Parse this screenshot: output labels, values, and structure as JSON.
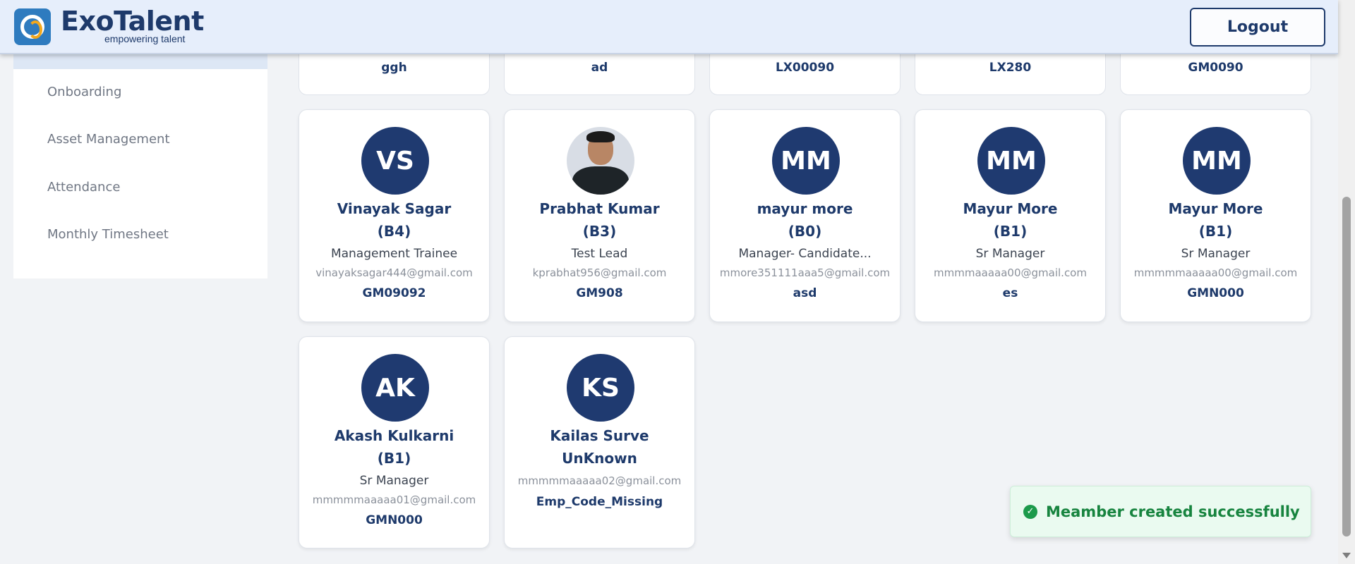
{
  "header": {
    "brand_name": "ExoTalent",
    "tagline": "empowering talent",
    "logout_label": "Logout"
  },
  "sidebar": {
    "items": [
      {
        "label": "Onboarding"
      },
      {
        "label": "Asset Management"
      },
      {
        "label": "Attendance"
      },
      {
        "label": "Monthly Timesheet"
      }
    ]
  },
  "top_row_codes": [
    "ggh",
    "ad",
    "LX00090",
    "LX280",
    "GM0090"
  ],
  "members": [
    {
      "initials": "VS",
      "name": "Vinayak Sagar",
      "band": "(B4)",
      "role": "Management Trainee",
      "email": "vinayaksagar444@gmail.com",
      "code": "GM09092"
    },
    {
      "initials": "",
      "name": "Prabhat Kumar",
      "band": "(B3)",
      "role": "Test Lead",
      "email": "kprabhat956@gmail.com",
      "code": "GM908"
    },
    {
      "initials": "MM",
      "name": "mayur more",
      "band": "(B0)",
      "role": "Manager- Candidate...",
      "email": "mmore351111aaa5@gmail.com",
      "code": "asd"
    },
    {
      "initials": "MM",
      "name": "Mayur More",
      "band": "(B1)",
      "role": "Sr Manager",
      "email": "mmmmaaaaa00@gmail.com",
      "code": "es"
    },
    {
      "initials": "MM",
      "name": "Mayur More",
      "band": "(B1)",
      "role": "Sr Manager",
      "email": "mmmmmaaaaa00@gmail.com",
      "code": "GMN000"
    },
    {
      "initials": "AK",
      "name": "Akash Kulkarni",
      "band": "(B1)",
      "role": "Sr Manager",
      "email": "mmmmmaaaaa01@gmail.com",
      "code": "GMN000"
    },
    {
      "initials": "KS",
      "name": "Kailas Surve",
      "band": "UnKnown",
      "email": "mmmmmaaaaa02@gmail.com",
      "code": "Emp_Code_Missing"
    }
  ],
  "toast": {
    "message": "Meamber created successfully"
  },
  "colors": {
    "brand": "#1e3a6b",
    "avatar": "#1f3a70",
    "success": "#17843f"
  }
}
